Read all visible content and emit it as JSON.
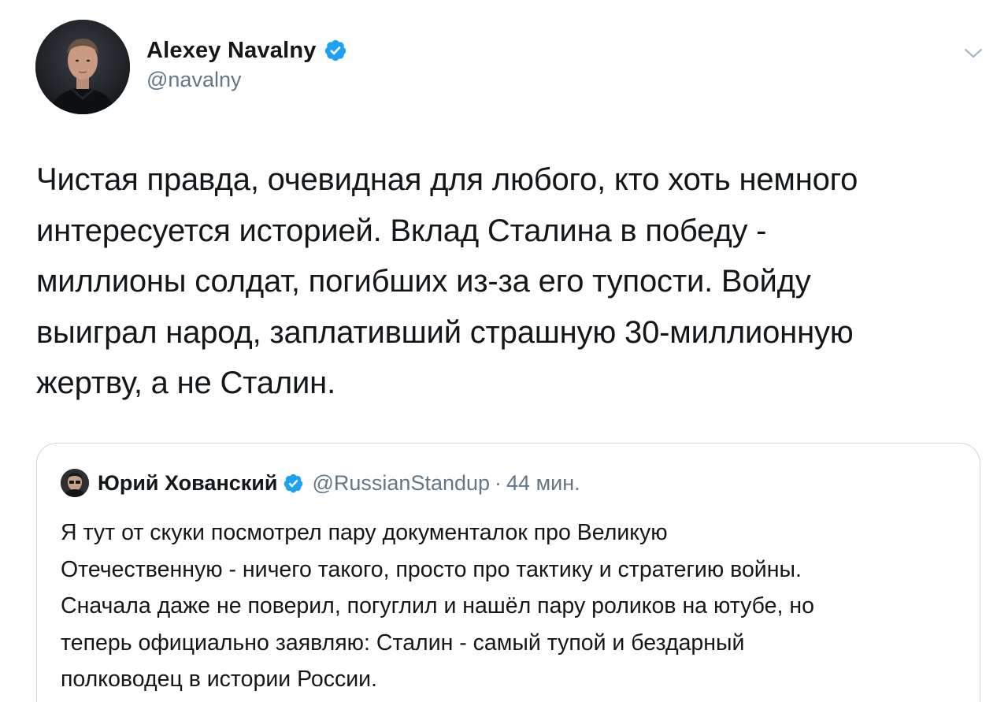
{
  "author": {
    "name": "Alexey Navalny",
    "handle": "@navalny",
    "verified": true
  },
  "icons": {
    "verified": "verified-badge-icon",
    "menu": "chevron-down-icon"
  },
  "tweet": {
    "text": "Чистая правда, очевидная для любого, кто хоть немного\nинтересуется историей. Вклад Сталина в победу -\nмиллионы солдат, погибших из-за его тупости. Войду\nвыиграл народ, заплативший страшную 30-миллионную\nжертву, а не Сталин."
  },
  "quoted_tweet": {
    "author_name": "Юрий Хованский",
    "handle": "@RussianStandup",
    "separator": "·",
    "time": "44 мин.",
    "verified": true,
    "text": "Я тут от скуки посмотрел пару документалок про Великую\nОтечественную - ничего такого, просто про тактику и стратегию войны.\nСначала даже не поверил, погуглил и нашёл пару роликов на ютубе, но\nтеперь официально заявляю: Сталин - самый тупой и бездарный\nполководец в истории России."
  },
  "colors": {
    "verified_blue": "#1da1f2",
    "text": "#14171a",
    "secondary": "#657786",
    "border": "#ccd6dd"
  }
}
